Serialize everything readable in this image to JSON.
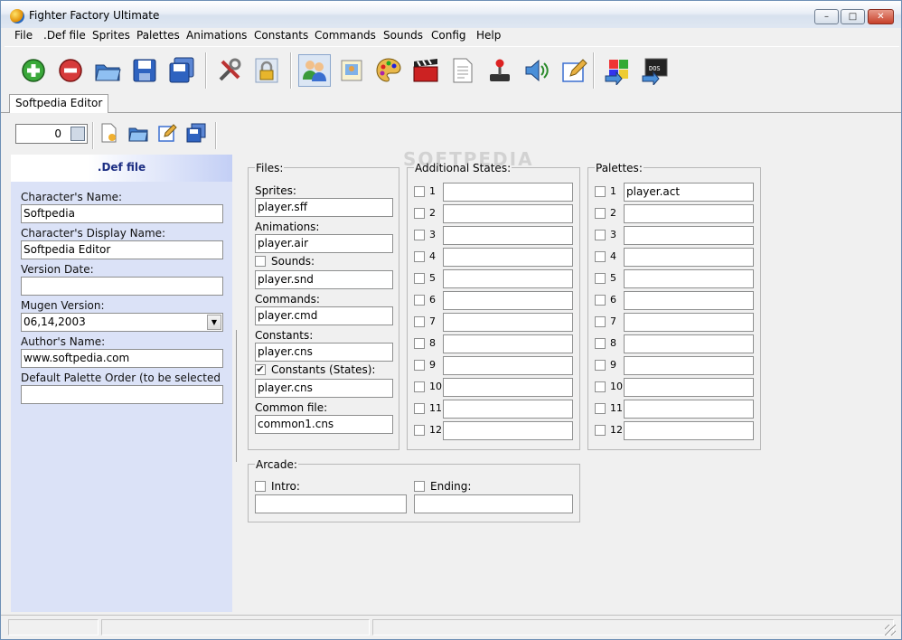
{
  "window": {
    "title": "Fighter Factory Ultimate",
    "min_label": "–",
    "max_label": "□",
    "close_label": "✕"
  },
  "menu": [
    "File",
    ".Def file",
    "Sprites",
    "Palettes",
    "Animations",
    "Constants",
    "Commands",
    "Sounds",
    "Config",
    "Help"
  ],
  "toolbar": {
    "icons": [
      "add-icon",
      "remove-icon",
      "open-icon",
      "save-icon",
      "save-all-icon",
      "tools-icon",
      "lock-icon",
      "characters-icon",
      "sprite-icon",
      "palette-icon",
      "animation-icon",
      "document-icon",
      "joystick-icon",
      "sound-icon",
      "edit-icon",
      "windows-export-icon",
      "dos-export-icon"
    ]
  },
  "tab": {
    "label": "Softpedia Editor"
  },
  "spinner": {
    "value": "0"
  },
  "def_panel": {
    "header": ".Def file",
    "fields": [
      {
        "label": "Character's Name:",
        "value": "Softpedia"
      },
      {
        "label": "Character's Display Name:",
        "value": "Softpedia Editor"
      },
      {
        "label": "Version Date:",
        "value": ""
      },
      {
        "label": "Mugen Version:",
        "value": "06,14,2003"
      },
      {
        "label": "Author's Name:",
        "value": "www.softpedia.com"
      },
      {
        "label": "Default Palette Order (to be selected by AI):",
        "value": ""
      }
    ]
  },
  "files": {
    "title": "Files:",
    "sprites_label": "Sprites:",
    "sprites_value": "player.sff",
    "animations_label": "Animations:",
    "animations_value": "player.air",
    "sounds_label": "Sounds:",
    "sounds_value": "player.snd",
    "sounds_checked": false,
    "commands_label": "Commands:",
    "commands_value": "player.cmd",
    "constants_label": "Constants:",
    "constants_value": "player.cns",
    "constants_states_label": "Constants (States):",
    "constants_states_value": "player.cns",
    "constants_states_checked": true,
    "common_label": "Common file:",
    "common_value": "common1.cns"
  },
  "additional_states": {
    "title": "Additional States:",
    "rows": [
      {
        "num": "1",
        "value": ""
      },
      {
        "num": "2",
        "value": ""
      },
      {
        "num": "3",
        "value": ""
      },
      {
        "num": "4",
        "value": ""
      },
      {
        "num": "5",
        "value": ""
      },
      {
        "num": "6",
        "value": ""
      },
      {
        "num": "7",
        "value": ""
      },
      {
        "num": "8",
        "value": ""
      },
      {
        "num": "9",
        "value": ""
      },
      {
        "num": "10",
        "value": ""
      },
      {
        "num": "11",
        "value": ""
      },
      {
        "num": "12",
        "value": ""
      }
    ]
  },
  "palettes": {
    "title": "Palettes:",
    "rows": [
      {
        "num": "1",
        "value": "player.act"
      },
      {
        "num": "2",
        "value": ""
      },
      {
        "num": "3",
        "value": ""
      },
      {
        "num": "4",
        "value": ""
      },
      {
        "num": "5",
        "value": ""
      },
      {
        "num": "6",
        "value": ""
      },
      {
        "num": "7",
        "value": ""
      },
      {
        "num": "8",
        "value": ""
      },
      {
        "num": "9",
        "value": ""
      },
      {
        "num": "10",
        "value": ""
      },
      {
        "num": "11",
        "value": ""
      },
      {
        "num": "12",
        "value": ""
      }
    ]
  },
  "arcade": {
    "title": "Arcade:",
    "intro_label": "Intro:",
    "intro_value": "",
    "ending_label": "Ending:",
    "ending_value": ""
  },
  "watermark": "SOFTPEDIA",
  "colors": {
    "panel_bg": "#dbe2f7",
    "panel_header_text": "#1c2e83",
    "window_border": "#6d8fb5"
  }
}
